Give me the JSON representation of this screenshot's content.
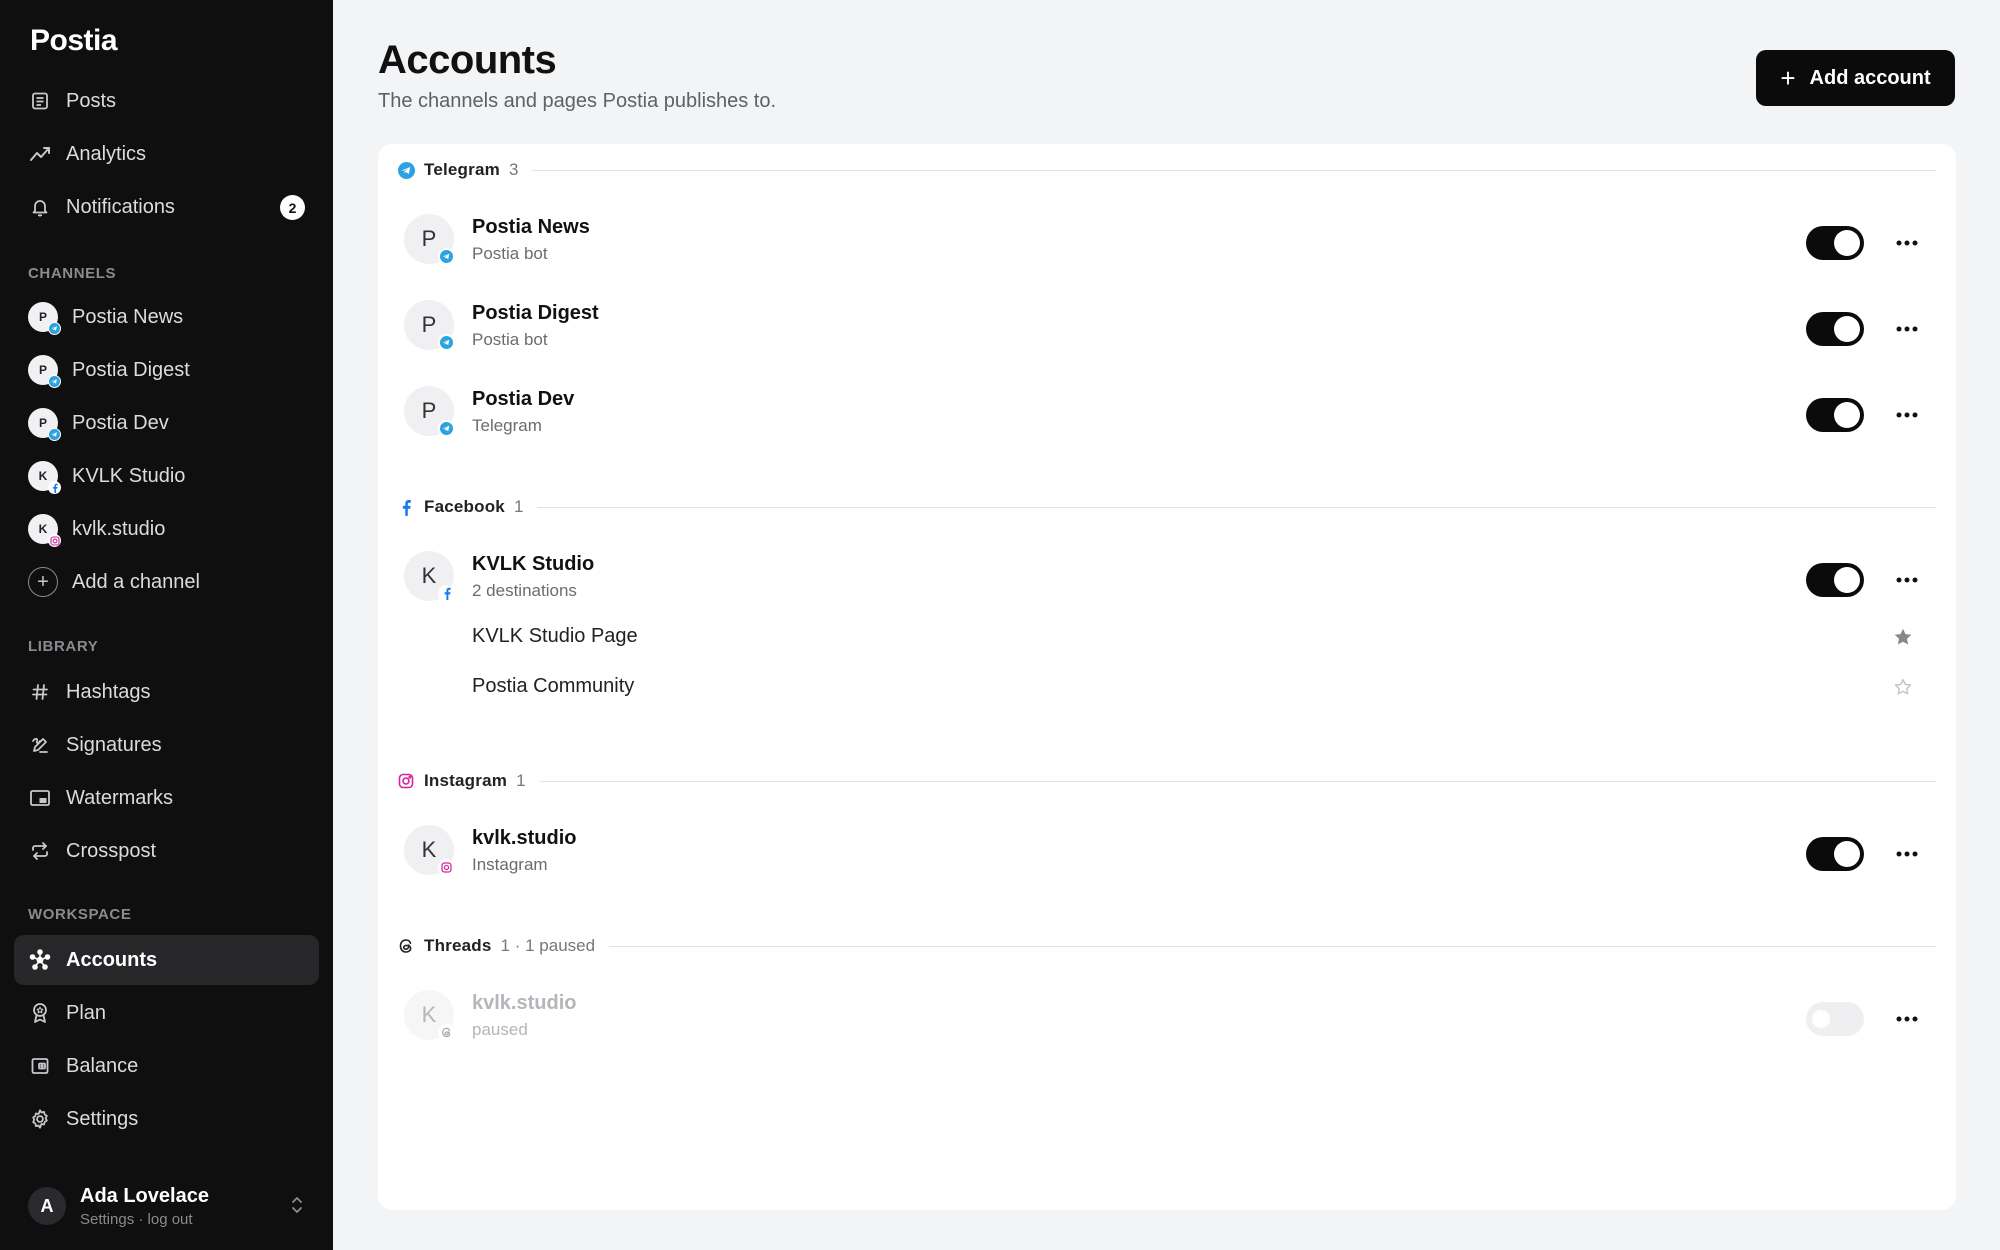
{
  "app": {
    "name": "Postia"
  },
  "sidebar": {
    "nav": [
      {
        "label": "Posts"
      },
      {
        "label": "Analytics"
      },
      {
        "label": "Notifications",
        "badge": "2"
      }
    ],
    "channels_label": "CHANNELS",
    "channels": [
      {
        "initial": "P",
        "label": "Postia News",
        "network": "telegram"
      },
      {
        "initial": "P",
        "label": "Postia Digest",
        "network": "telegram"
      },
      {
        "initial": "P",
        "label": "Postia Dev",
        "network": "telegram"
      },
      {
        "initial": "K",
        "label": "KVLK Studio",
        "network": "facebook"
      },
      {
        "initial": "K",
        "label": "kvlk.studio",
        "network": "instagram"
      }
    ],
    "add_channel": "Add a channel",
    "library_label": "LIBRARY",
    "library": [
      {
        "label": "Hashtags"
      },
      {
        "label": "Signatures"
      },
      {
        "label": "Watermarks"
      },
      {
        "label": "Crosspost"
      }
    ],
    "workspace_label": "WORKSPACE",
    "workspace": [
      {
        "label": "Accounts",
        "active": true
      },
      {
        "label": "Plan"
      },
      {
        "label": "Balance"
      },
      {
        "label": "Settings"
      }
    ],
    "user": {
      "initial": "A",
      "name": "Ada Lovelace",
      "sub": "Settings · log out"
    }
  },
  "main": {
    "title": "Accounts",
    "subtitle": "The channels and pages Postia publishes to.",
    "add_button": "Add account",
    "groups": {
      "telegram": {
        "name": "Telegram",
        "count": "3",
        "accounts": [
          {
            "initial": "P",
            "name": "Postia News",
            "sub": "Postia bot",
            "enabled": true
          },
          {
            "initial": "P",
            "name": "Postia Digest",
            "sub": "Postia bot",
            "enabled": true
          },
          {
            "initial": "P",
            "name": "Postia Dev",
            "sub": "Telegram",
            "enabled": true
          }
        ]
      },
      "facebook": {
        "name": "Facebook",
        "count": "1",
        "accounts": [
          {
            "initial": "K",
            "name": "KVLK Studio",
            "sub": "2 destinations",
            "enabled": true,
            "destinations": [
              {
                "name": "KVLK Studio Page",
                "starred": true
              },
              {
                "name": "Postia Community",
                "starred": false
              }
            ]
          }
        ]
      },
      "instagram": {
        "name": "Instagram",
        "count": "1",
        "accounts": [
          {
            "initial": "K",
            "name": "kvlk.studio",
            "sub": "Instagram",
            "enabled": true
          }
        ]
      },
      "threads": {
        "name": "Threads",
        "count": "1 · 1 paused",
        "accounts": [
          {
            "initial": "K",
            "name": "kvlk.studio",
            "sub": "paused",
            "enabled": false
          }
        ]
      }
    }
  },
  "colors": {
    "sidebar_bg": "#0f0f10",
    "accent": "#0b0b0c",
    "telegram": "#2aa3e0",
    "facebook": "#1877f2",
    "instagram": "#d6249f",
    "page_bg": "#f3f4f6"
  }
}
